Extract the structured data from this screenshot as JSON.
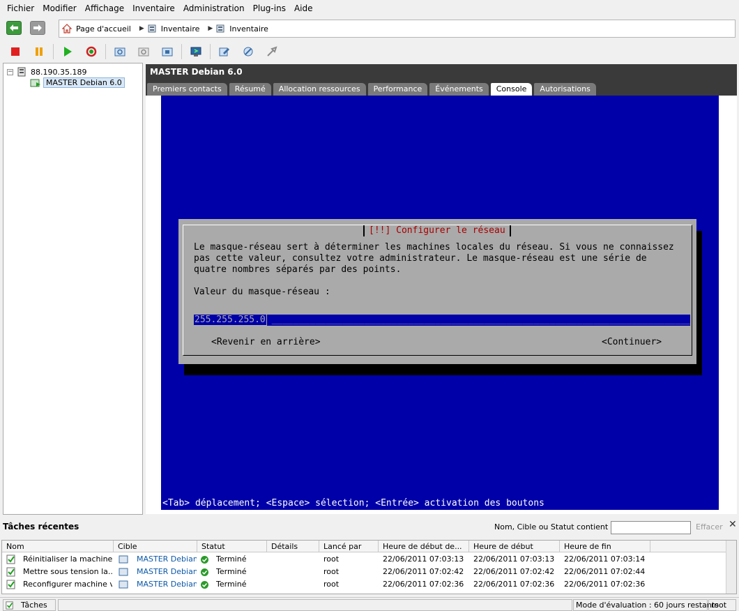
{
  "menu": [
    "Fichier",
    "Modifier",
    "Affichage",
    "Inventaire",
    "Administration",
    "Plug-ins",
    "Aide"
  ],
  "breadcrumb": {
    "items": [
      {
        "icon": "home-icon",
        "label": "Page d'accueil"
      },
      {
        "icon": "inventory-icon",
        "label": "Inventaire"
      },
      {
        "icon": "inventory-icon",
        "label": "Inventaire"
      }
    ]
  },
  "toolbar": {
    "buttons": [
      "stop-icon",
      "pause-icon",
      "play-icon",
      "reset-icon",
      "snapshot-icon",
      "revert-snapshot-icon",
      "snapshot-manager-icon",
      "console-icon",
      "edit-settings-icon",
      "tools-icon",
      "migrate-icon"
    ]
  },
  "tree": {
    "host": "88.190.35.189",
    "vm": "MASTER Debian 6.0",
    "expander": "−"
  },
  "main": {
    "title": "MASTER Debian 6.0",
    "tabs": [
      "Premiers contacts",
      "Résumé",
      "Allocation ressources",
      "Performance",
      "Événements",
      "Console",
      "Autorisations"
    ],
    "active_tab": "Console"
  },
  "console": {
    "dialog_title": "[!!] Configurer le réseau",
    "desc_line1": "Le masque-réseau sert à déterminer les machines locales du réseau. Si vous ne connaissez",
    "desc_line2": "pas cette valeur, consultez votre administrateur. Le masque-réseau est une série de",
    "desc_line3": "quatre nombres séparés par des points.",
    "prompt": "Valeur du masque-réseau :",
    "input_value": "255.255.255.0",
    "input_fill": "____________________________________________________________________________________",
    "back_button": "<Revenir en arrière>",
    "continue_button": "<Continuer>",
    "footer": "<Tab> déplacement; <Espace> sélection; <Entrée> activation des boutons",
    "colors": {
      "background": "#0000a8",
      "dialog": "#aaaaaa",
      "title": "#a80000"
    }
  },
  "tasks": {
    "title": "Tâches récentes",
    "filter_label": "Nom, Cible ou Statut contient : ▾",
    "filter_value": "",
    "clear_label": "Effacer",
    "close_label": "✕",
    "columns": [
      "Nom",
      "Cible",
      "Statut",
      "Détails",
      "Lancé par",
      "Heure de début de...",
      "Heure de début",
      "Heure de fin"
    ],
    "rows": [
      {
        "name": "Réinitialiser la machine...",
        "target": "MASTER Debian...",
        "status": "Terminé",
        "details": "",
        "by": "root",
        "queued": "22/06/2011 07:03:13",
        "start": "22/06/2011 07:03:13",
        "end": "22/06/2011 07:03:14"
      },
      {
        "name": "Mettre sous tension la...",
        "target": "MASTER Debian...",
        "status": "Terminé",
        "details": "",
        "by": "root",
        "queued": "22/06/2011 07:02:42",
        "start": "22/06/2011 07:02:42",
        "end": "22/06/2011 07:02:44"
      },
      {
        "name": "Reconfigurer machine v...",
        "target": "MASTER Debian...",
        "status": "Terminé",
        "details": "",
        "by": "root",
        "queued": "22/06/2011 07:02:36",
        "start": "22/06/2011 07:02:36",
        "end": "22/06/2011 07:02:36"
      }
    ]
  },
  "statusbar": {
    "tasks_label": "Tâches",
    "eval_label": "Mode d'évaluation : 60 jours restants",
    "user": "root"
  }
}
